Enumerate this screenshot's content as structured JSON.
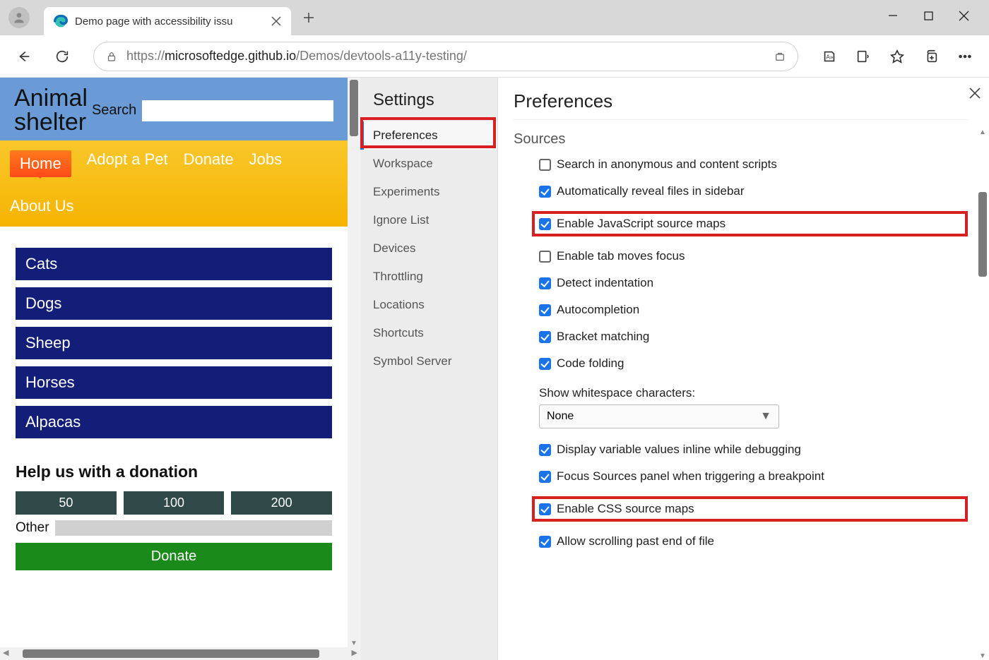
{
  "window": {
    "tab_title": "Demo page with accessibility issu",
    "url_prefix": "https://",
    "url_host": "microsoftedge.github.io",
    "url_path": "/Demos/devtools-a11y-testing/"
  },
  "page": {
    "title_line1": "Animal",
    "title_line2": "shelter",
    "search_label": "Search",
    "nav": [
      "Home",
      "Adopt a Pet",
      "Donate",
      "Jobs",
      "About Us"
    ],
    "categories": [
      "Cats",
      "Dogs",
      "Sheep",
      "Horses",
      "Alpacas"
    ],
    "donation_heading": "Help us with a donation",
    "amounts": [
      "50",
      "100",
      "200"
    ],
    "other_label": "Other",
    "donate_label": "Donate"
  },
  "devtools": {
    "sidebar_title": "Settings",
    "categories": [
      "Preferences",
      "Workspace",
      "Experiments",
      "Ignore List",
      "Devices",
      "Throttling",
      "Locations",
      "Shortcuts",
      "Symbol Server"
    ],
    "active_category": "Preferences",
    "main_title": "Preferences",
    "section_title": "Sources",
    "options": [
      {
        "label": "Search in anonymous and content scripts",
        "checked": false,
        "highlight": false
      },
      {
        "label": "Automatically reveal files in sidebar",
        "checked": true,
        "highlight": false
      },
      {
        "label": "Enable JavaScript source maps",
        "checked": true,
        "highlight": true
      },
      {
        "label": "Enable tab moves focus",
        "checked": false,
        "highlight": false
      },
      {
        "label": "Detect indentation",
        "checked": true,
        "highlight": false
      },
      {
        "label": "Autocompletion",
        "checked": true,
        "highlight": false
      },
      {
        "label": "Bracket matching",
        "checked": true,
        "highlight": false
      },
      {
        "label": "Code folding",
        "checked": true,
        "highlight": false
      }
    ],
    "whitespace_label": "Show whitespace characters:",
    "whitespace_value": "None",
    "options2": [
      {
        "label": "Display variable values inline while debugging",
        "checked": true,
        "highlight": false
      },
      {
        "label": "Focus Sources panel when triggering a breakpoint",
        "checked": true,
        "highlight": false
      },
      {
        "label": "Enable CSS source maps",
        "checked": true,
        "highlight": true
      },
      {
        "label": "Allow scrolling past end of file",
        "checked": true,
        "highlight": false
      }
    ]
  }
}
